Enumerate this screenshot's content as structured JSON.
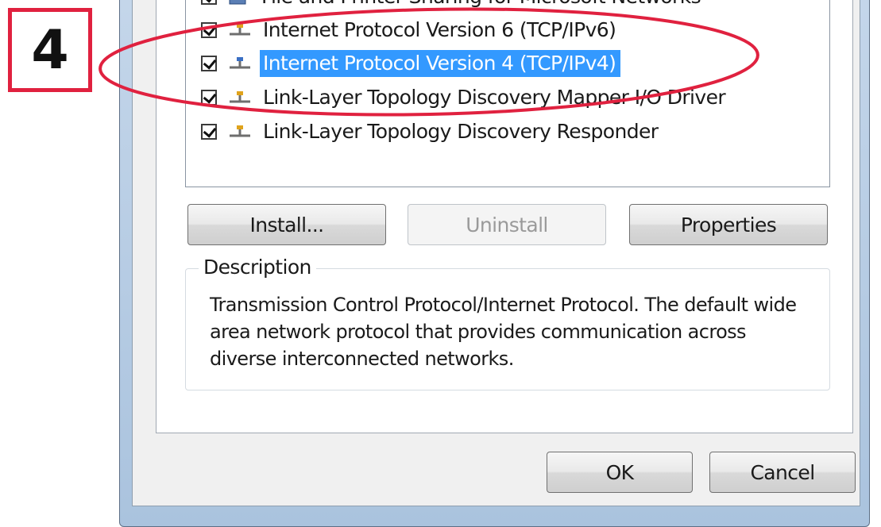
{
  "annotation": {
    "step_number": "4",
    "badge_color": "#e0213f",
    "highlight_color": "#e0213f"
  },
  "dialog": {
    "components": [
      {
        "label": "File and Printer Sharing for Microsoft Networks",
        "checked": true,
        "icon": "file-printer-sharing-icon",
        "selected": false
      },
      {
        "label": "Internet Protocol Version 6 (TCP/IPv6)",
        "checked": true,
        "icon": "network-protocol-icon",
        "selected": false
      },
      {
        "label": "Internet Protocol Version 4 (TCP/IPv4)",
        "checked": true,
        "icon": "network-protocol-icon",
        "selected": true
      },
      {
        "label": "Link-Layer Topology Discovery Mapper I/O Driver",
        "checked": true,
        "icon": "network-protocol-icon",
        "selected": false
      },
      {
        "label": "Link-Layer Topology Discovery Responder",
        "checked": true,
        "icon": "network-protocol-icon",
        "selected": false
      }
    ],
    "buttons": {
      "install": "Install...",
      "uninstall": "Uninstall",
      "properties": "Properties",
      "ok": "OK",
      "cancel": "Cancel"
    },
    "description": {
      "title": "Description",
      "text": "Transmission Control Protocol/Internet Protocol. The default wide area network protocol that provides communication across diverse interconnected networks."
    },
    "selection_color": "#3399ff"
  }
}
